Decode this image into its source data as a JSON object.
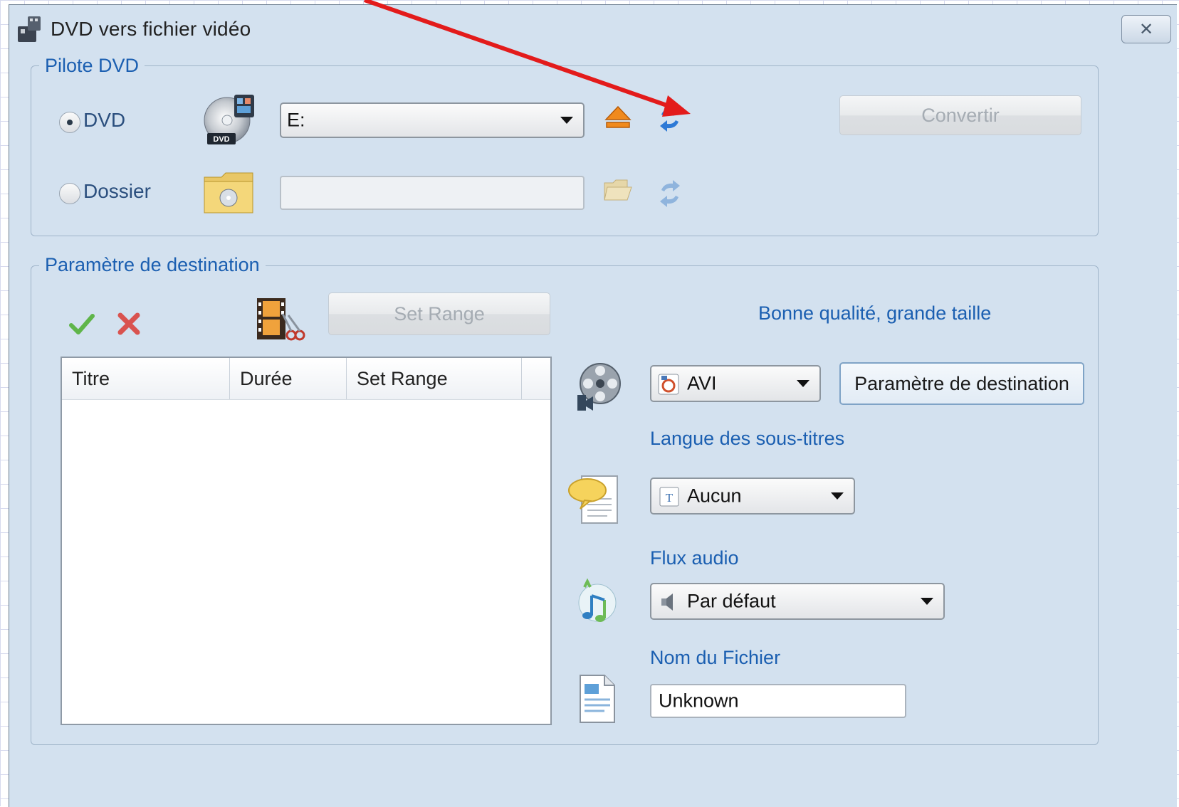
{
  "window": {
    "title": "DVD vers fichier vidéo",
    "close_glyph": "✕",
    "icon": "app-dvd-icon"
  },
  "pilote": {
    "legend": "Pilote DVD",
    "dvd_radio_label": "DVD",
    "dvd_radio_checked": true,
    "dossier_radio_label": "Dossier",
    "dossier_radio_checked": false,
    "drive_value": "E:",
    "folder_path": "",
    "convert_label": "Convertir"
  },
  "destination": {
    "legend": "Paramètre de destination",
    "set_range_label": "Set Range",
    "quality_text": "Bonne qualité, grande taille",
    "format_value": "AVI",
    "dest_button_label": "Paramètre de destination",
    "subtitles_label": "Langue des sous-titres",
    "subtitles_value": "Aucun",
    "audio_label": "Flux audio",
    "audio_value": "Par défaut",
    "filename_label": "Nom du Fichier",
    "filename_value": "Unknown",
    "columns": [
      "Titre",
      "Durée",
      "Set Range"
    ]
  },
  "colors": {
    "annotation_arrow": "#e31b1b",
    "window_bg": "#d3e1ef",
    "label_blue": "#1b5fb1"
  }
}
